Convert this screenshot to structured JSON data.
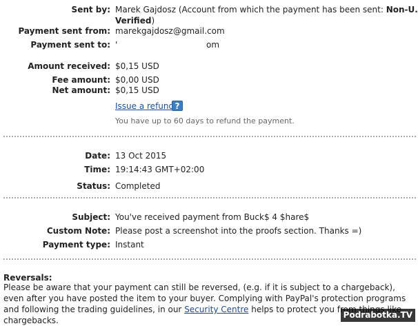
{
  "details": {
    "sent_by": {
      "label": "Sent by:",
      "name_prefix": "Marek Gajdosz (Account from which the payment has been sent: ",
      "status_bold_1": "Non-U.S. -",
      "status_bold_2": "Verified",
      "status_suffix": ")"
    },
    "payment_sent_from": {
      "label": "Payment sent from:",
      "value": "marekgajdosz@gmail.com"
    },
    "payment_sent_to": {
      "label": "Payment sent to:",
      "value_start": "'",
      "value_end": "om"
    }
  },
  "amounts": {
    "amount_received": {
      "label": "Amount received:",
      "value": "$0,15 USD"
    },
    "fee_amount": {
      "label": "Fee amount:",
      "value": "$0,00 USD"
    },
    "net_amount": {
      "label": "Net amount:",
      "value": "$0,15 USD"
    },
    "refund_link": "Issue a refund",
    "help_icon": "?",
    "refund_hint": "You have up to 60 days to refund the payment."
  },
  "status_section": {
    "date": {
      "label": "Date:",
      "value": "13 Oct 2015"
    },
    "time": {
      "label": "Time:",
      "value": "19:14:43 GMT+02:00"
    },
    "status": {
      "label": "Status:",
      "value": "Completed"
    }
  },
  "message_section": {
    "subject": {
      "label": "Subject:",
      "value": "You've received payment from Buck$ 4 $hare$"
    },
    "custom_note": {
      "label": "Custom Note:",
      "value": "Please post a screenshot into the proofs section. Thanks =)"
    },
    "payment_type": {
      "label": "Payment type:",
      "value": "Instant"
    }
  },
  "reversals": {
    "title": "Reversals:",
    "text_before_link": "Please be aware that your payment can still be reversed, (e.g. if it is subject to a chargeback), even after you have posted the item to your buyer. Complying with PayPal's protection programs and following the trading guidelines, in our ",
    "link_text": "Security Centre",
    "text_after_link": " helps to protect you from things like chargebacks."
  },
  "watermark": "Podrabotka.TV",
  "colors": {
    "link": "#1e4b8f",
    "separator": "#a9a9a9",
    "help_icon": "#3a7fc4"
  }
}
